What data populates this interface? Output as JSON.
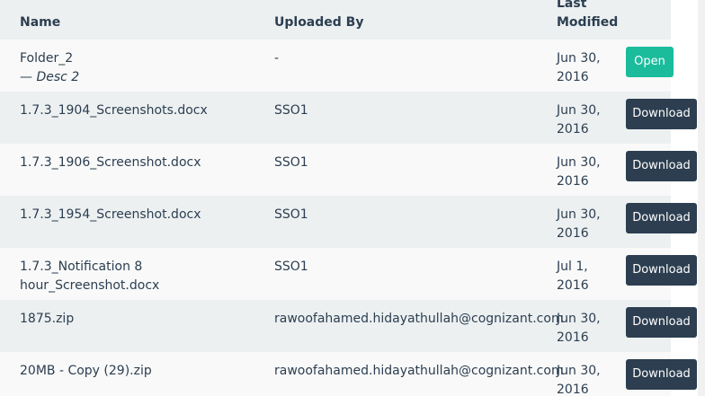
{
  "columns": {
    "name": "Name",
    "uploaded_by": "Uploaded By",
    "last_modified": "Last Modified"
  },
  "rows": [
    {
      "name": "Folder_2",
      "desc": "— Desc 2",
      "uploaded_by": "-",
      "modified": "Jun 30, 2016",
      "action": "Open"
    },
    {
      "name": "1.7.3_1904_Screenshots.docx",
      "uploaded_by": "SSO1",
      "modified": "Jun 30, 2016",
      "action": "Download"
    },
    {
      "name": "1.7.3_1906_Screenshot.docx",
      "uploaded_by": "SSO1",
      "modified": "Jun 30, 2016",
      "action": "Download"
    },
    {
      "name": "1.7.3_1954_Screenshot.docx",
      "uploaded_by": "SSO1",
      "modified": "Jun 30, 2016",
      "action": "Download"
    },
    {
      "name": "1.7.3_Notification 8 hour_Screenshot.docx",
      "uploaded_by": "SSO1",
      "modified": "Jul 1, 2016",
      "action": "Download"
    },
    {
      "name": "1875.zip",
      "uploaded_by": "rawoofahamed.hidayathullah@cognizant.com",
      "modified": "Jun 30, 2016",
      "action": "Download"
    },
    {
      "name": "20MB - Copy (29).zip",
      "uploaded_by": "rawoofahamed.hidayathullah@cognizant.com",
      "modified": "Jun 30, 2016",
      "action": "Download"
    }
  ],
  "colors": {
    "shaded_row": "#ecf0f1",
    "plain_row": "#f9f9f9",
    "open_button": "#1abc9c",
    "download_button": "#2c3e50",
    "text": "#2c3e50"
  }
}
